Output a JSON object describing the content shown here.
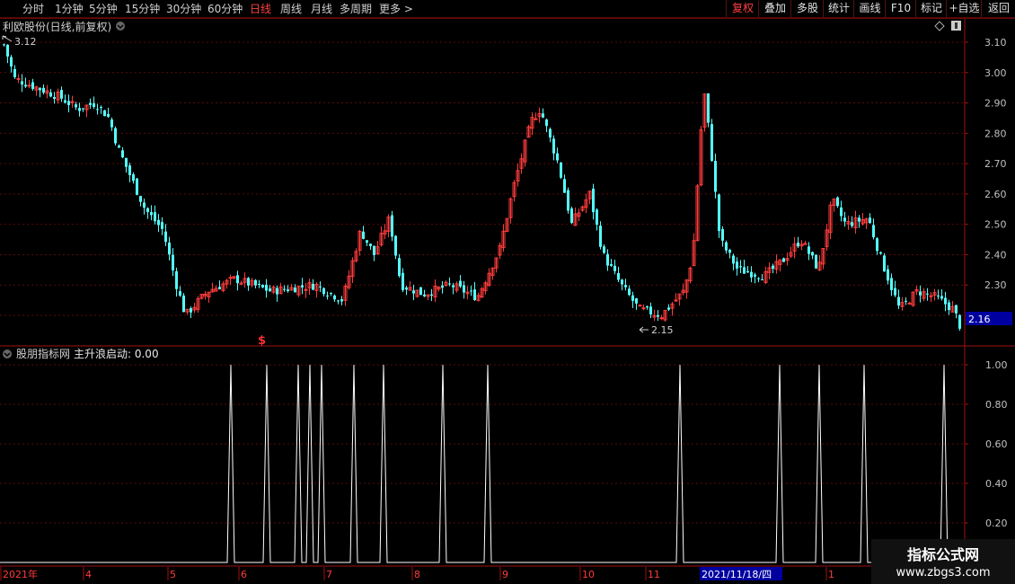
{
  "toolbar": {
    "periods": [
      "分时",
      "1分钟",
      "5分钟",
      "15分钟",
      "30分钟",
      "60分钟",
      "日线",
      "周线",
      "月线",
      "多周期",
      "更多 >"
    ],
    "active_period": "日线",
    "buttons": [
      "复权",
      "叠加",
      "多股",
      "统计",
      "画线",
      "F10",
      "标记",
      "+自选",
      "返回"
    ],
    "active_button": "复权"
  },
  "main_chart": {
    "title": "利欧股份(日线,前复权)",
    "high_label": "3.12",
    "low_label": "2.15",
    "current_price": "2.16",
    "signal_mark": "$",
    "y_ticks": [
      "3.10",
      "3.00",
      "2.90",
      "2.80",
      "2.70",
      "2.60",
      "2.50",
      "2.40",
      "2.30",
      "2.20"
    ]
  },
  "indicator": {
    "title": "股朋指标网",
    "series_label": "主升浪启动: 0.00",
    "y_ticks": [
      "1.00",
      "0.80",
      "0.60",
      "0.40",
      "0.20"
    ]
  },
  "x_axis": {
    "labels": [
      "2021年",
      "4",
      "5",
      "6",
      "7",
      "8",
      "9",
      "10",
      "11",
      "1"
    ],
    "cursor_date": "2021/11/18/四"
  },
  "watermark": {
    "title": "指标公式网",
    "url": "www.zbgs3.com"
  },
  "colors": {
    "up": "#ff3c3c",
    "down": "#54ffff",
    "axis": "#a01010",
    "signal": "#ffffff",
    "cursor_bg": "#0000a0"
  },
  "chart_data": [
    {
      "type": "candlestick",
      "title": "利欧股份(日线,前复权)",
      "ylim": [
        2.15,
        3.13
      ],
      "trend_close": [
        [
          0,
          3.12
        ],
        [
          15,
          2.98
        ],
        [
          40,
          2.95
        ],
        [
          65,
          2.92
        ],
        [
          85,
          2.88
        ],
        [
          105,
          2.9
        ],
        [
          120,
          2.85
        ],
        [
          130,
          2.75
        ],
        [
          145,
          2.65
        ],
        [
          160,
          2.55
        ],
        [
          180,
          2.48
        ],
        [
          195,
          2.3
        ],
        [
          205,
          2.2
        ],
        [
          230,
          2.28
        ],
        [
          260,
          2.32
        ],
        [
          300,
          2.28
        ],
        [
          350,
          2.3
        ],
        [
          380,
          2.25
        ],
        [
          400,
          2.48
        ],
        [
          415,
          2.4
        ],
        [
          432,
          2.52
        ],
        [
          445,
          2.3
        ],
        [
          470,
          2.27
        ],
        [
          500,
          2.3
        ],
        [
          530,
          2.26
        ],
        [
          555,
          2.42
        ],
        [
          570,
          2.62
        ],
        [
          590,
          2.84
        ],
        [
          600,
          2.88
        ],
        [
          620,
          2.7
        ],
        [
          635,
          2.5
        ],
        [
          655,
          2.6
        ],
        [
          670,
          2.4
        ],
        [
          690,
          2.3
        ],
        [
          710,
          2.22
        ],
        [
          735,
          2.2
        ],
        [
          760,
          2.28
        ],
        [
          770,
          2.4
        ],
        [
          782,
          2.95
        ],
        [
          790,
          2.75
        ],
        [
          800,
          2.45
        ],
        [
          820,
          2.35
        ],
        [
          850,
          2.33
        ],
        [
          870,
          2.38
        ],
        [
          890,
          2.45
        ],
        [
          910,
          2.35
        ],
        [
          925,
          2.58
        ],
        [
          940,
          2.5
        ],
        [
          965,
          2.52
        ],
        [
          980,
          2.38
        ],
        [
          1000,
          2.22
        ],
        [
          1020,
          2.28
        ],
        [
          1040,
          2.26
        ],
        [
          1060,
          2.22
        ],
        [
          1068,
          2.16
        ]
      ]
    },
    {
      "type": "line",
      "title": "主升浪启动",
      "ylim": [
        0,
        1.05
      ],
      "signal_positions": [
        257,
        297,
        332,
        345,
        358,
        394,
        427,
        493,
        543,
        757,
        868,
        912,
        962,
        1051
      ],
      "signal_value": 1.0,
      "current_value": 0.0
    }
  ]
}
